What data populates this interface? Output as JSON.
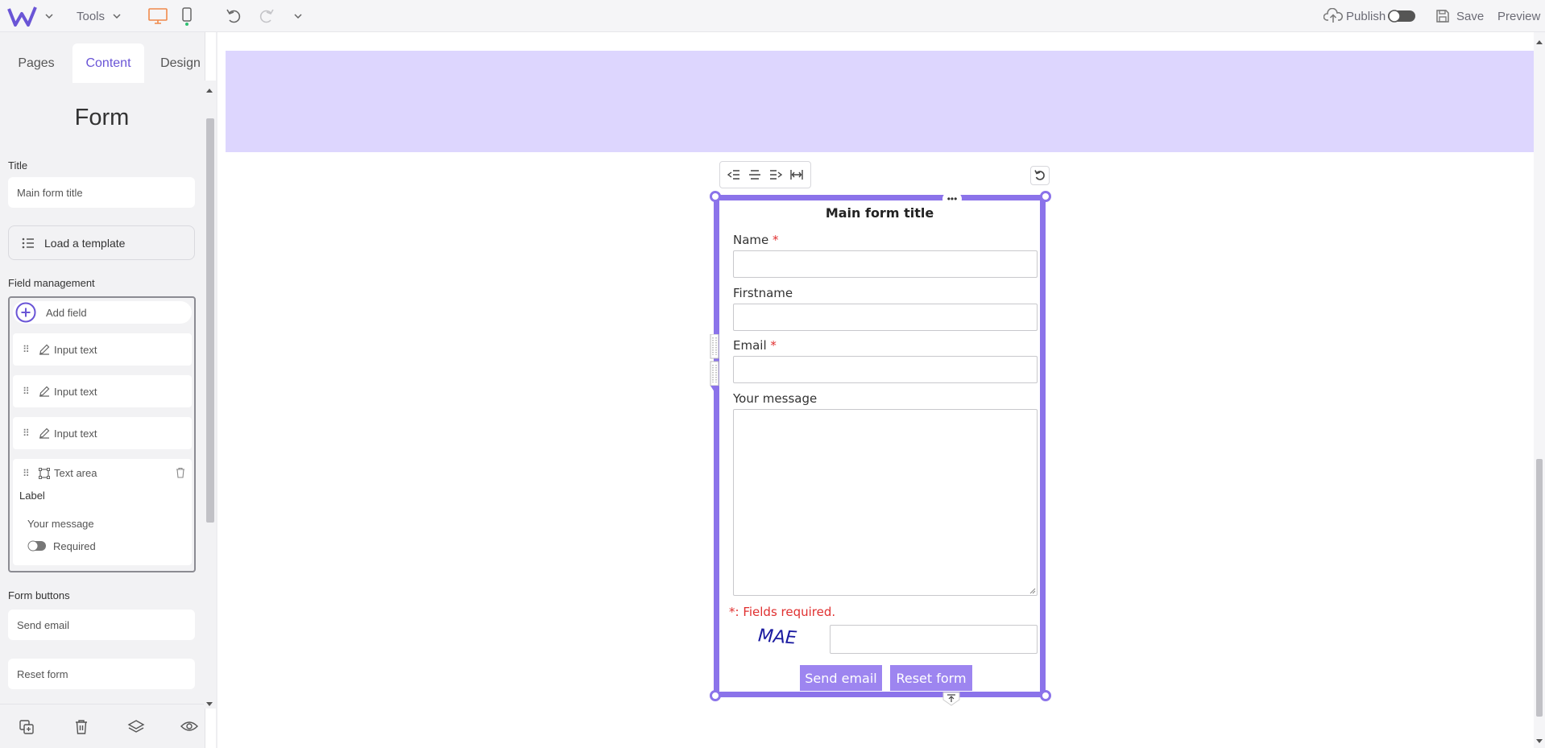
{
  "topbar": {
    "tools_label": "Tools",
    "publish_label": "Publish",
    "save_label": "Save",
    "preview_label": "Preview",
    "accent_color": "#6a55d6",
    "desktop_color": "#f08a4b"
  },
  "sidebar": {
    "tabs": [
      {
        "label": "Pages"
      },
      {
        "label": "Content"
      },
      {
        "label": "Design"
      }
    ],
    "panel_title": "Form",
    "title_label": "Title",
    "title_value": "Main form title",
    "load_template_label": "Load a template",
    "field_management_label": "Field management",
    "add_field_label": "Add field",
    "fields": [
      {
        "type_label": "Input text"
      },
      {
        "type_label": "Input text"
      },
      {
        "type_label": "Input text"
      },
      {
        "type_label": "Text area"
      }
    ],
    "expanded_field": {
      "label_heading": "Label",
      "label_value": "Your message",
      "required_label": "Required"
    },
    "form_buttons_label": "Form buttons",
    "send_email_value": "Send email",
    "reset_form_value": "Reset form"
  },
  "form": {
    "title": "Main form title",
    "fields": [
      {
        "label": "Name",
        "required": "*"
      },
      {
        "label": "Firstname",
        "required": ""
      },
      {
        "label": "Email",
        "required": "*"
      },
      {
        "label": "Your message",
        "required": ""
      }
    ],
    "required_note": "*: Fields required.",
    "captcha_text": "MAE",
    "send_label": "Send email",
    "reset_label": "Reset form",
    "frame_color": "#8b73ea",
    "banner_color": "#ddd6fe"
  }
}
